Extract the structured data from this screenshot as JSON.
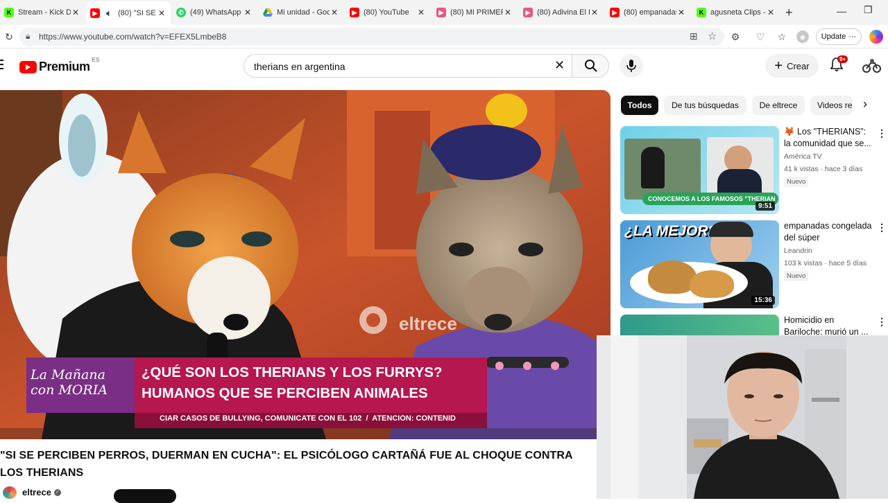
{
  "browser": {
    "tabs": [
      {
        "title": "Stream - Kick Da",
        "favicon": "kick-icon",
        "color": "#53fc18"
      },
      {
        "title": "(80) \"SI SE P",
        "favicon": "youtube-icon",
        "color": "#ff0000",
        "active": true
      },
      {
        "title": "(49) WhatsApp",
        "favicon": "whatsapp-icon",
        "color": "#25d366"
      },
      {
        "title": "Mi unidad - Goo",
        "favicon": "drive-icon",
        "color": "#4285f4"
      },
      {
        "title": "(80) YouTube",
        "favicon": "youtube-icon",
        "color": "#ff0000"
      },
      {
        "title": "(80) MI PRIMER",
        "favicon": "youtube-icon",
        "color": "#ff0000"
      },
      {
        "title": "(80) Adivina El P",
        "favicon": "youtube-icon",
        "color": "#ff0000"
      },
      {
        "title": "(80) empanadas",
        "favicon": "youtube-icon",
        "color": "#ff0000"
      },
      {
        "title": "agusneta Clips -",
        "favicon": "kick-icon",
        "color": "#53fc18"
      }
    ],
    "url": "https://www.youtube.com/watch?v=EFEX5LmbeB8",
    "update_label": "Update"
  },
  "youtube": {
    "logo_text": "Premium",
    "logo_region": "ES",
    "search_value": "therians en argentina",
    "create_label": "Crear",
    "notif_count": "9+",
    "chips": [
      "Todos",
      "De tus búsquedas",
      "De eltrece",
      "Videos re"
    ],
    "video": {
      "watermark": "eltrece",
      "banner_show": "La Mañana con MORIA",
      "banner_line1": "¿QUÉ SON LOS THERIANS Y LOS FURRYS?",
      "banner_line2": "HUMANOS QUE SE PERCIBEN ANIMALES",
      "ticker": "CIAR CASOS DE BULLYING, COMUNICATE CON EL 102  /  ATENCIÓN: CONTENID"
    },
    "title": "\"SI SE PERCIBEN PERROS, DUERMAN EN CUCHA\": EL PSICÓLOGO CARTAÑÁ FUE AL CHOQUE CONTRA LOS THERIANS",
    "channel": "eltrece",
    "recommended": [
      {
        "title": "🦊 Los \"THERIANS\": la comunidad que se...",
        "channel": "América TV",
        "meta": "41 k vistas · hace 3 días",
        "badge": "Nuevo",
        "duration": "9:51",
        "thumb_caption": "CONOCEMOS A LOS FAMOSOS \"THERIAN"
      },
      {
        "title": "empanadas congelada del súper",
        "channel": "Leandrin",
        "meta": "103 k vistas · hace 5 días",
        "badge": "Nuevo",
        "duration": "15:36",
        "thumb_caption": "¿LA MEJOR?"
      },
      {
        "title": "Homicidio en Bariloche: murió un ...",
        "channel": "",
        "meta": "",
        "badge": "",
        "duration": "",
        "thumb_caption": ""
      }
    ]
  }
}
